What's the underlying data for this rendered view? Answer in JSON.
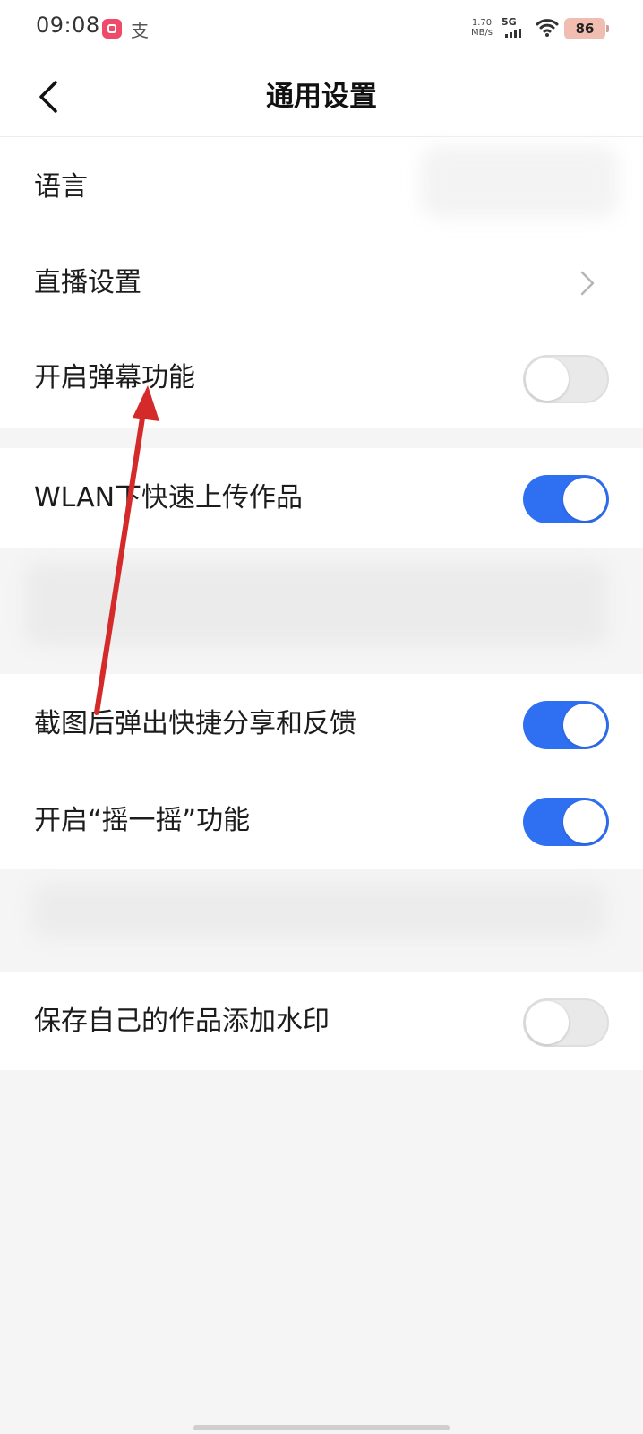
{
  "status_bar": {
    "time": "09:08",
    "alipay_glyph": "支",
    "net_speed_value": "1.70",
    "net_speed_unit": "MB/s",
    "network_type": "5G",
    "battery_level": "86",
    "icons": [
      "app-notification-icon",
      "alipay-icon",
      "signal-icon",
      "wifi-icon",
      "battery-icon"
    ]
  },
  "header": {
    "title": "通用设置",
    "back_icon": "chevron-left-icon"
  },
  "section1": {
    "language_label": "语言",
    "live_settings_label": "直播设置",
    "danmaku_label": "开启弹幕功能",
    "danmaku_toggle": false
  },
  "section2": {
    "wlan_upload_label": "WLAN下快速上传作品",
    "wlan_upload_toggle": true
  },
  "section3": {
    "screenshot_share_label": "截图后弹出快捷分享和反馈",
    "screenshot_share_toggle": true,
    "shake_label": "开启“摇一摇”功能",
    "shake_toggle": true
  },
  "section4": {
    "watermark_label": "保存自己的作品添加水印",
    "watermark_toggle": false
  },
  "colors": {
    "toggle_on": "#2f6ff2",
    "toggle_off": "#e9e9e9",
    "annotation_arrow": "#d42a2a",
    "background": "#f5f5f5"
  }
}
